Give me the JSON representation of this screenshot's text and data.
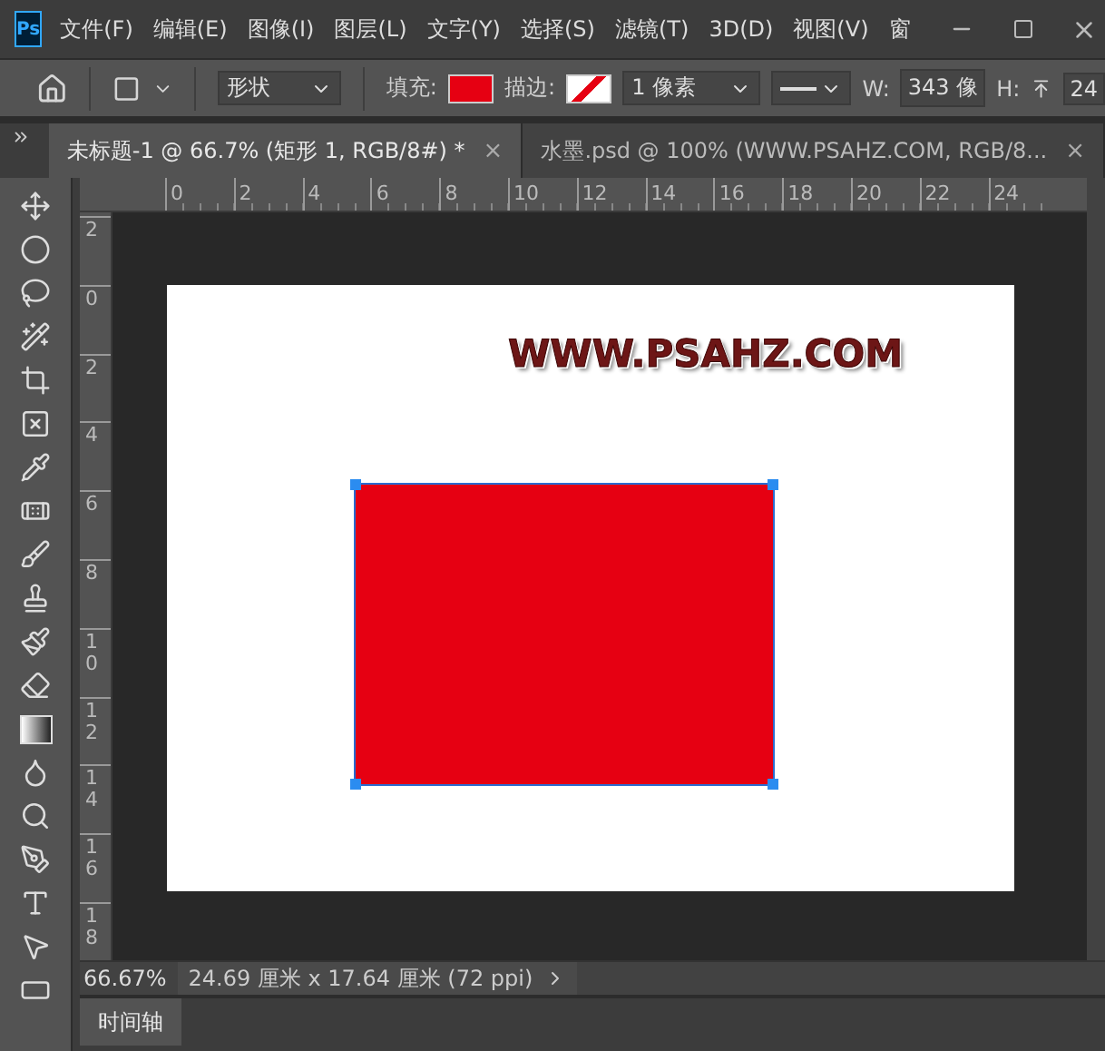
{
  "app": {
    "logo": "Ps"
  },
  "menu": [
    "文件(F)",
    "编辑(E)",
    "图像(I)",
    "图层(L)",
    "文字(Y)",
    "选择(S)",
    "滤镜(T)",
    "3D(D)",
    "视图(V)",
    "窗"
  ],
  "options_bar": {
    "mode": "形状",
    "fill_label": "填充:",
    "stroke_label": "描边:",
    "stroke_width": "1 像素",
    "w_label": "W:",
    "w_value": "343 像",
    "h_label": "H:",
    "h_value": "24"
  },
  "tabs": [
    {
      "label": "未标题-1 @ 66.7% (矩形 1, RGB/8#) *",
      "selected": true,
      "close": "×"
    },
    {
      "label": "水墨.psd @ 100% (WWW.PSAHZ.COM, RGB/8...",
      "selected": false,
      "close": "×"
    }
  ],
  "ruler": {
    "horizontal": [
      "0",
      "2",
      "4",
      "6",
      "8",
      "10",
      "12",
      "14",
      "16",
      "18",
      "20",
      "22",
      "24"
    ],
    "vertical": [
      "2",
      "0",
      "2",
      "4",
      "6",
      "8",
      "10",
      "12",
      "14",
      "16",
      "18"
    ]
  },
  "canvas": {
    "text_layer": "WWW.PSAHZ.COM",
    "shape_selected": true
  },
  "status_bar": {
    "zoom": "66.67%",
    "doc_size": "24.69 厘米 x 17.64 厘米 (72 ppi)"
  },
  "panel_tabs": [
    {
      "label": "时间轴",
      "selected": true
    }
  ]
}
